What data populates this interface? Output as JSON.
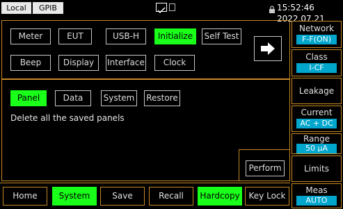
{
  "status": {
    "local": "Local",
    "gpib": "GPIB",
    "time": "15:52:46 2022.07.21"
  },
  "top_buttons": {
    "meter": "Meter",
    "eut": "EUT",
    "usbh": "USB-H",
    "initialize": "Initialize",
    "selftest": "Self Test",
    "beep": "Beep",
    "display": "Display",
    "interface": "Interface",
    "clock": "Clock"
  },
  "tabs": {
    "panel": "Panel",
    "data": "Data",
    "system": "System",
    "restore": "Restore"
  },
  "message": "Delete all the saved panels",
  "perform": "Perform",
  "side": {
    "network_title": "Network",
    "network_value": "F-F(ON)",
    "class_title": "Class",
    "class_value": "I-CF",
    "leakage_title": "Leakage",
    "current_title": "Current",
    "current_value": "AC + DC",
    "range_title": "Range",
    "range_value": "50 μA",
    "limits_title": "Limits",
    "meas_title": "Meas",
    "meas_value": "AUTO"
  },
  "bottom": {
    "home": "Home",
    "system": "System",
    "save": "Save",
    "recall": "Recall",
    "hardcopy": "Hardcopy",
    "keylock": "Key Lock"
  },
  "colors": {
    "accent_green": "#19ff19",
    "frame_orange": "#c88a25",
    "value_blue": "#00a6cc"
  }
}
